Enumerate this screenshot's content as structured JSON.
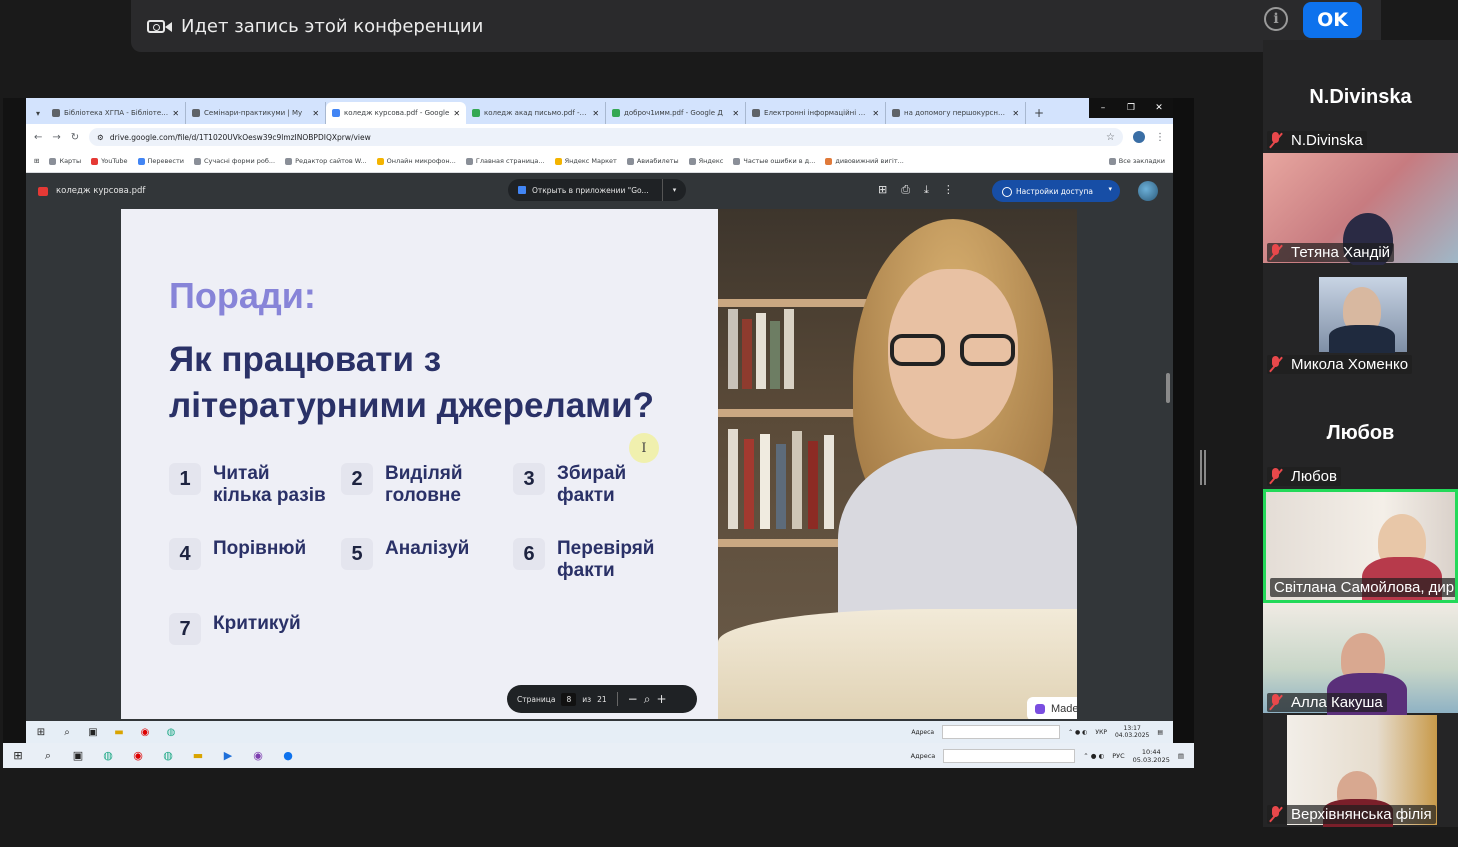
{
  "banner": {
    "text": "Идет запись этой конференции",
    "info_icon": "i",
    "ok_label": "OK"
  },
  "browser": {
    "tabs": [
      {
        "title": "Бібліотека ХГПА - Бібліотека"
      },
      {
        "title": "Семінари-практикуми | My"
      },
      {
        "title": "коледж курсова.pdf - Google",
        "active": true
      },
      {
        "title": "коледж акад письмо.pdf - Go"
      },
      {
        "title": "доброч1имм.pdf - Google Д"
      },
      {
        "title": "Електронні інформаційні рес"
      },
      {
        "title": "на допомогу першокурснику"
      }
    ],
    "tab_close": "✕",
    "new_tab": "+",
    "url": "drive.google.com/file/d/1T1020UVkOesw39c9lmzINOBPDIQXprw/view",
    "bookmarks": [
      "Карты",
      "YouTube",
      "Перевести",
      "Сучасні форми роб...",
      "Редактор сайтов W...",
      "Онлайн микрофон...",
      "Главная страница...",
      "Яндекс Маркет",
      "Авиабилеты",
      "Яндекс",
      "Частые ошибки в д...",
      "дивовижний вигіт..."
    ],
    "bookmarks_all": "Все закладки",
    "window_controls": [
      "–",
      "❐",
      "✕"
    ]
  },
  "pdf": {
    "file_name": "коледж курсова.pdf",
    "open_with": "Открыть в приложении \"Go...",
    "share_label": "Настройки доступа",
    "page_label": "Страница",
    "page_current": "8",
    "page_of": "из",
    "page_total": "21",
    "zoom_out": "−",
    "zoom_search": "⌕",
    "zoom_in": "+"
  },
  "slide": {
    "heading": "Поради:",
    "subheading_line1": "Як працювати з",
    "subheading_line2": "літературними джерелами?",
    "tips": [
      {
        "num": "1",
        "label": "Читай кілька разів"
      },
      {
        "num": "2",
        "label": "Виділяй головне"
      },
      {
        "num": "3",
        "label": "Збирай факти"
      },
      {
        "num": "4",
        "label": "Порівнюй"
      },
      {
        "num": "5",
        "label": "Аналізуй"
      },
      {
        "num": "6",
        "label": "Перевіряй факти"
      },
      {
        "num": "7",
        "label": "Критикуй"
      }
    ],
    "cursor": "I",
    "badge": "Made with Gamma"
  },
  "inner_taskbar": {
    "address_label": "Адреса",
    "lang": "УКР",
    "time": "13:17",
    "date": "04.03.2025"
  },
  "outer_taskbar": {
    "address_label": "Адреса",
    "lang": "РУС",
    "time": "10:44",
    "date": "05.03.2025"
  },
  "gallery": {
    "tiles": [
      {
        "big_name": "N.Divinska",
        "label": "N.Divinska"
      },
      {
        "label": "Тетяна Хандій"
      },
      {
        "label": "Микола Хоменко"
      },
      {
        "big_name": "Любов",
        "label": "Любов"
      },
      {
        "label": "Світлана Самойлова, дир..."
      },
      {
        "label": "Алла Какуша"
      },
      {
        "label": "Верхівнянська філія"
      }
    ]
  },
  "colors": {
    "zoom_blue": "#0e72ed",
    "speaking_green": "#23d959",
    "mute_red": "#e8484b",
    "slide_heading": "#8784d8",
    "slide_text": "#2a3167"
  }
}
